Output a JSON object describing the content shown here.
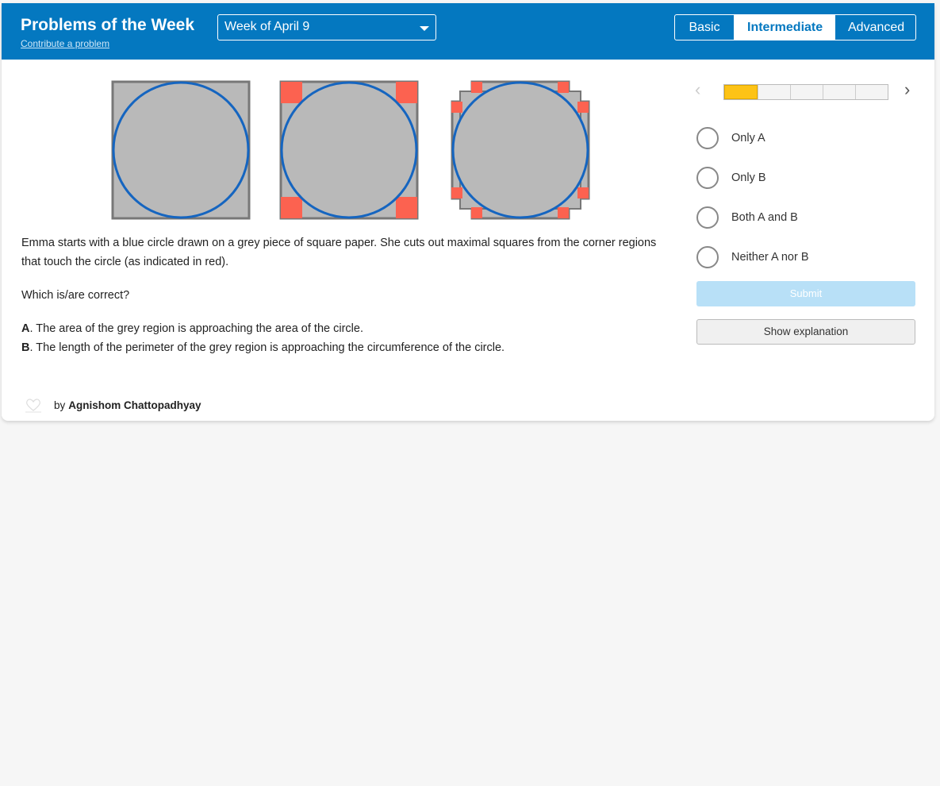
{
  "header": {
    "title": "Problems of the Week",
    "contribute_link": "Contribute a problem",
    "week_select": "Week of April 9",
    "levels": [
      "Basic",
      "Intermediate",
      "Advanced"
    ],
    "active_level": "Intermediate"
  },
  "problem": {
    "statement": "Emma starts with a blue circle drawn on a grey piece of square paper. She cuts out maximal squares from the corner regions that touch the circle (as indicated in red).",
    "question": "Which is/are correct?",
    "claims": [
      {
        "key": "A",
        "text": ". The area of the grey region is approaching the area of the circle."
      },
      {
        "key": "B",
        "text": ". The length of the perimeter of the grey region is approaching the circumference of the circle."
      }
    ]
  },
  "author": {
    "prefix": "by",
    "name": "Agnishom Chattopadhyay"
  },
  "pager": {
    "total_segments": 5,
    "current_segment": 1
  },
  "options": [
    "Only A",
    "Only B",
    "Both A and B",
    "Neither A nor B"
  ],
  "buttons": {
    "submit": "Submit",
    "explanation": "Show explanation"
  },
  "colors": {
    "header_bg": "#0478c0",
    "grey_paper": "#b9b9b9",
    "circle_stroke": "#1565c0",
    "cutout_red": "#fc6250",
    "progress_current": "#fdc316"
  }
}
